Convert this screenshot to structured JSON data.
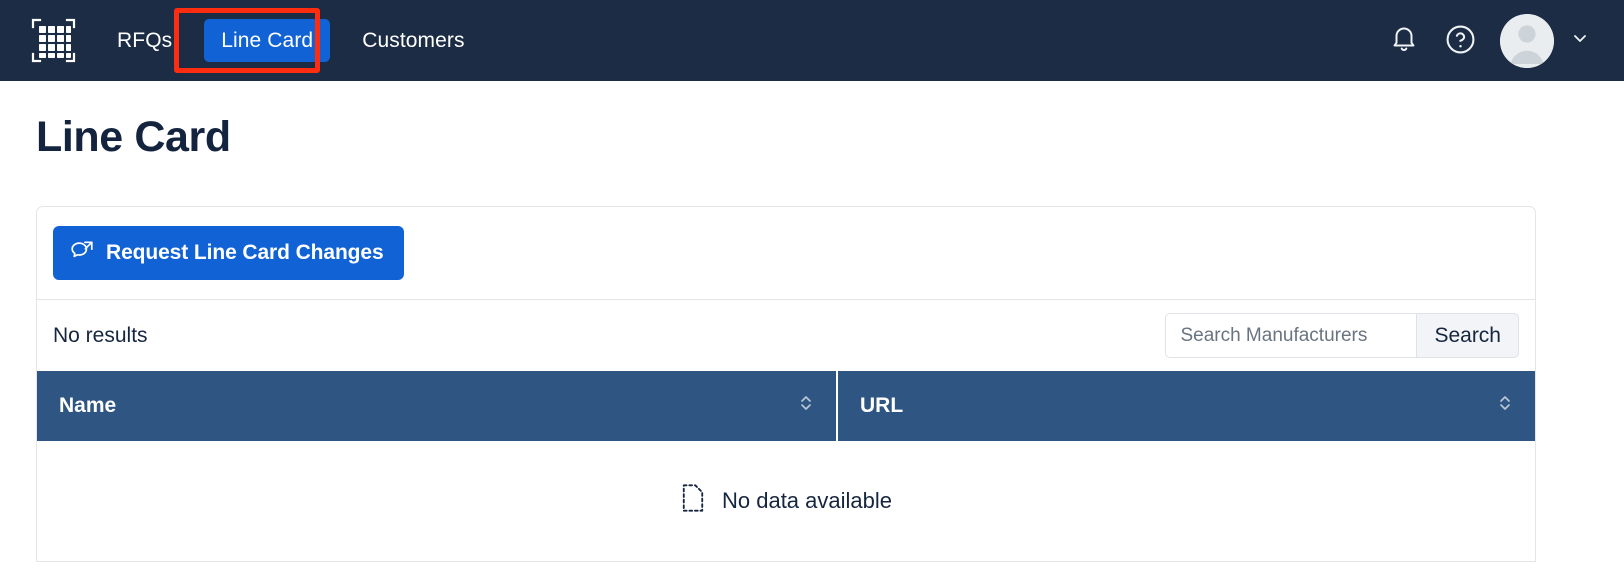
{
  "navbar": {
    "logo_icon": "grid-scan-logo-icon",
    "links": [
      {
        "label": "RFQs",
        "active": false
      },
      {
        "label": "Line Card",
        "active": true
      },
      {
        "label": "Customers",
        "active": false
      }
    ],
    "notifications_icon": "bell-icon",
    "help_icon": "question-circle-icon",
    "avatar_icon": "user-avatar-icon",
    "caret_icon": "chevron-down-icon",
    "background_color": "#1b2c44",
    "active_link_color": "#1162d4",
    "highlight_color": "#ff2d10"
  },
  "page": {
    "title": "Line Card"
  },
  "toolbar": {
    "request_changes_label": "Request Line Card Changes",
    "request_changes_icon": "chat-bubbles-icon",
    "primary_color": "#1162d4"
  },
  "subbar": {
    "results_text": "No results",
    "search_placeholder": "Search Manufacturers",
    "search_value": "",
    "search_button_label": "Search",
    "search_icon": "search-icon"
  },
  "table": {
    "header_color": "#2f5582",
    "columns": [
      {
        "label": "Name",
        "sort_icon": "sort-updown-icon"
      },
      {
        "label": "URL",
        "sort_icon": "sort-updown-icon"
      }
    ],
    "rows": [],
    "empty_state_text": "No data available",
    "empty_state_icon": "empty-document-icon"
  }
}
